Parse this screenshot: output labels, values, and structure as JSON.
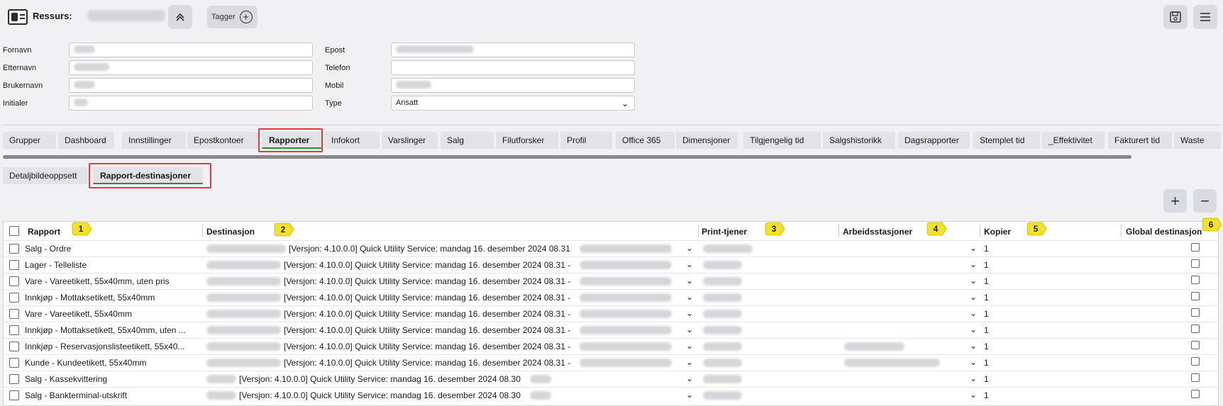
{
  "header": {
    "title": "Ressurs:",
    "tags_label": "Tagger"
  },
  "form": {
    "fornavn_label": "Fornavn",
    "etternavn_label": "Etternavn",
    "brukernavn_label": "Brukernavn",
    "initialer_label": "Initialer",
    "epost_label": "Epost",
    "telefon_label": "Telefon",
    "mobil_label": "Mobil",
    "type_label": "Type",
    "type_value": "Ansatt"
  },
  "tabs": [
    "Grupper",
    "Dashboard",
    "Innstillinger",
    "Epostkontoer",
    "Rapporter",
    "Infokort",
    "Varslinger",
    "Salg",
    "Filutforsker",
    "Profil",
    "Office 365",
    "Dimensjoner",
    "Tilgjengelig tid",
    "Salgshistorikk",
    "Dagsrapporter",
    "Stemplet tid",
    "_Effektivitet",
    "Fakturert tid",
    "Waste"
  ],
  "active_tab": "Rapporter",
  "subtabs": [
    "Detaljbildeoppsett",
    "Rapport-destinasjoner"
  ],
  "active_subtab": "Rapport-destinasjoner",
  "table": {
    "columns": [
      "Rapport",
      "Destinasjon",
      "Print-tjener",
      "Arbeidsstasjoner",
      "Kopier",
      "Global destinasjon"
    ],
    "rows": [
      {
        "rapport": "Salg - Ordre",
        "destinasjon": "[Versjon: 4.10.0.0] Quick Utility Service: mandag 16. desember 2024 08.31",
        "kopier": "1"
      },
      {
        "rapport": "Lager - Telleliste",
        "destinasjon": "[Versjon: 4.10.0.0] Quick Utility Service: mandag 16. desember 2024 08.31 -",
        "kopier": "1"
      },
      {
        "rapport": "Vare - Vareetikett, 55x40mm, uten pris",
        "destinasjon": "[Versjon: 4.10.0.0] Quick Utility Service: mandag 16. desember 2024 08.31 -",
        "kopier": "1"
      },
      {
        "rapport": "Innkjøp - Mottaksetikett, 55x40mm",
        "destinasjon": "[Versjon: 4.10.0.0] Quick Utility Service: mandag 16. desember 2024 08.31 -",
        "kopier": "1"
      },
      {
        "rapport": "Vare - Vareetikett, 55x40mm",
        "destinasjon": "[Versjon: 4.10.0.0] Quick Utility Service: mandag 16. desember 2024 08.31 -",
        "kopier": "1"
      },
      {
        "rapport": "Innkjøp - Mottaksetikett, 55x40mm, uten ...",
        "destinasjon": "[Versjon: 4.10.0.0] Quick Utility Service: mandag 16. desember 2024 08.31 -",
        "kopier": "1"
      },
      {
        "rapport": "Innkjøp - Reservasjonslisteetikett, 55x40...",
        "destinasjon": "[Versjon: 4.10.0.0] Quick Utility Service: mandag 16. desember 2024 08.31 -",
        "kopier": "1"
      },
      {
        "rapport": "Kunde - Kundeetikett, 55x40mm",
        "destinasjon": "[Versjon: 4.10.0.0] Quick Utility Service: mandag 16. desember 2024 08.31 -",
        "kopier": "1"
      },
      {
        "rapport": "Salg - Kassekvittering",
        "destinasjon": "[Versjon: 4.10.0.0] Quick Utility Service: mandag 16. desember 2024 08.30",
        "kopier": "1"
      },
      {
        "rapport": "Salg - Bankterminal-utskrift",
        "destinasjon": "[Versjon: 4.10.0.0] Quick Utility Service: mandag 16. desember 2024 08.30",
        "kopier": "1"
      }
    ]
  },
  "markers": [
    "1",
    "2",
    "3",
    "4",
    "5",
    "6"
  ]
}
